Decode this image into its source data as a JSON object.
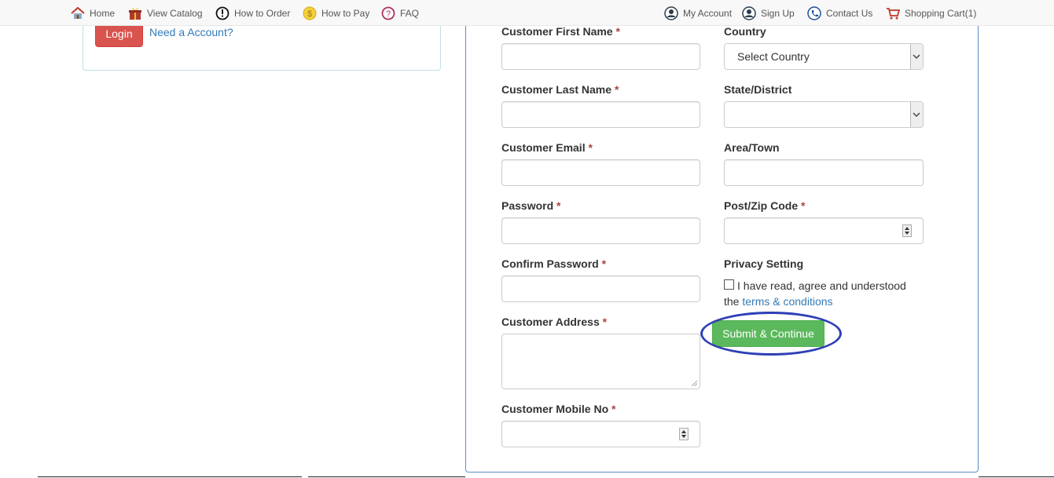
{
  "nav": {
    "home": "Home",
    "view_catalog": "View Catalog",
    "how_to_order": "How to Order",
    "how_to_pay": "How to Pay",
    "faq": "FAQ",
    "my_account": "My Account",
    "sign_up": "Sign Up",
    "contact_us": "Contact Us",
    "shopping_cart": "Shopping Cart(1)"
  },
  "login": {
    "button": "Login",
    "need_account": "Need a Account?"
  },
  "form": {
    "required_mark": "*",
    "first_name_label": "Customer First Name",
    "last_name_label": "Customer Last Name",
    "email_label": "Customer Email",
    "password_label": "Password",
    "confirm_password_label": "Confirm Password",
    "address_label": "Customer Address",
    "mobile_label": "Customer Mobile No",
    "country_label": "Country",
    "country_value": "Select Country",
    "state_label": "State/District",
    "area_label": "Area/Town",
    "postcode_label": "Post/Zip Code",
    "privacy_label": "Privacy Setting",
    "privacy_text": "I have read, agree and understood the ",
    "terms_link": "terms & conditions",
    "submit": "Submit & Continue"
  },
  "colors": {
    "login_button": "#d9534f",
    "submit_button": "#5cb85c",
    "link": "#337ab7",
    "highlight_ring": "#2d3fb5"
  }
}
